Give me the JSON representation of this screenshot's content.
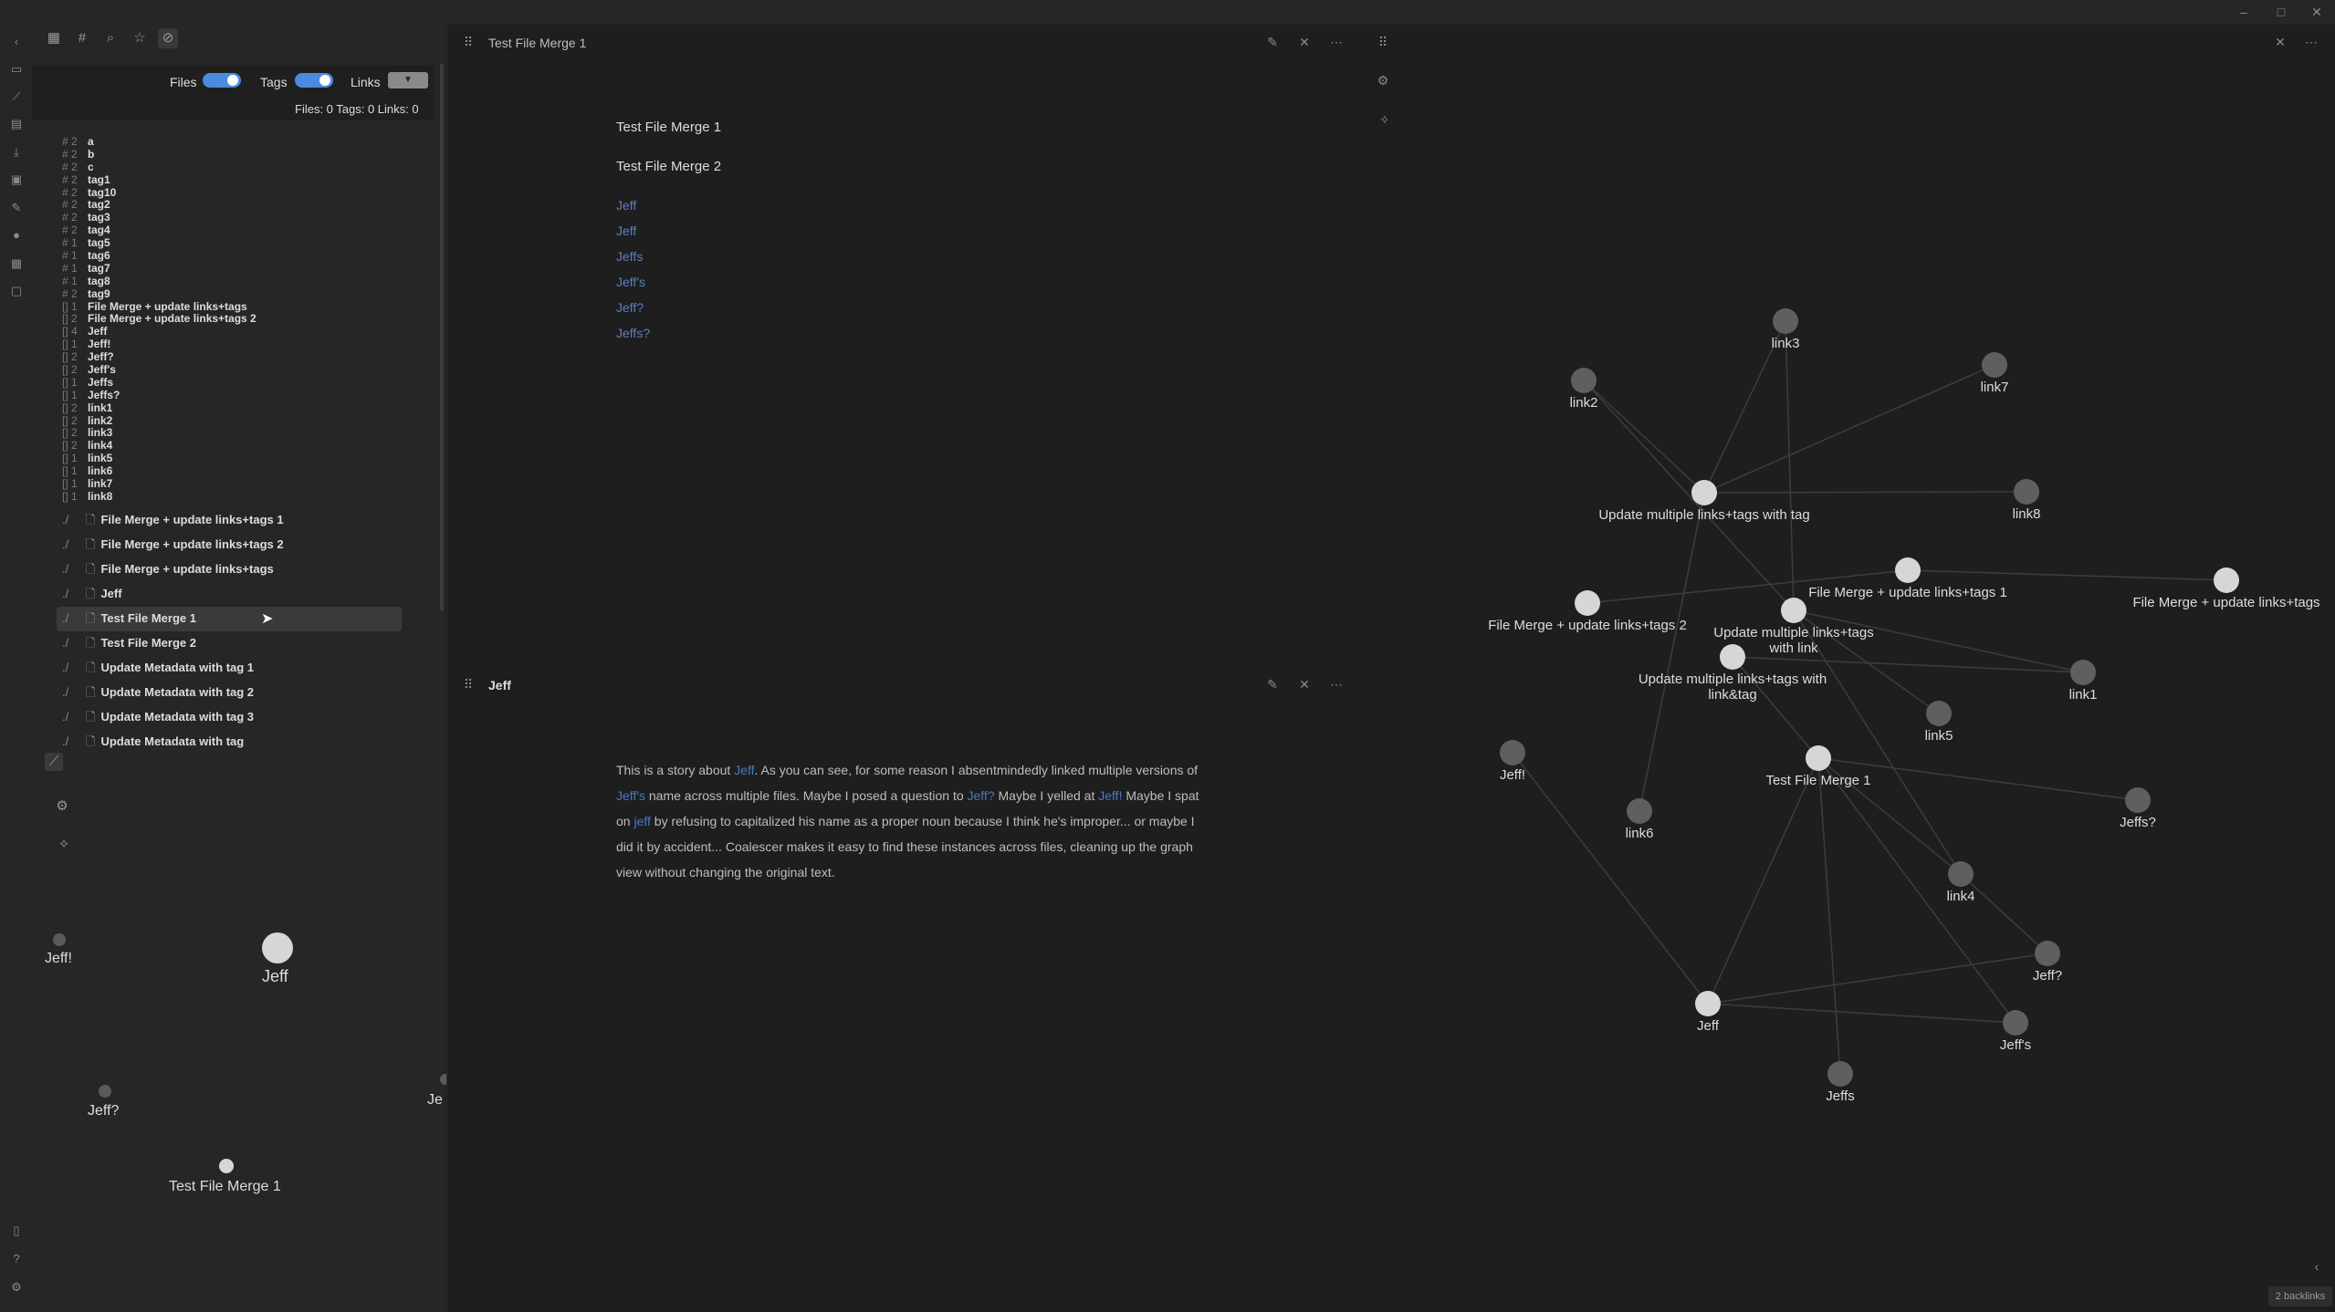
{
  "window": {
    "controls": [
      "–",
      "□",
      "✕"
    ]
  },
  "ribbon": {
    "icons": [
      "chevron-left-icon",
      "file-icon",
      "graph-icon",
      "terminal-icon",
      "download-icon",
      "inbox-icon",
      "edit-icon",
      "mic-icon",
      "table-icon",
      "calendar-icon",
      "book-icon",
      "help-icon",
      "settings-icon"
    ]
  },
  "sidebar": {
    "tab_icons": [
      "files-tab-icon",
      "tags-tab-icon",
      "search-tab-icon",
      "star-tab-icon",
      "coalescer-tab-icon"
    ],
    "filters": {
      "files_label": "Files",
      "tags_label": "Tags",
      "links_label": "Links",
      "counts": "Files: 0 Tags: 0 Links: 0",
      "files_on": true,
      "tags_on": true
    },
    "tags": [
      {
        "count": "# 2",
        "name": "a"
      },
      {
        "count": "# 2",
        "name": "b"
      },
      {
        "count": "# 2",
        "name": "c"
      },
      {
        "count": "# 2",
        "name": "tag1"
      },
      {
        "count": "# 2",
        "name": "tag10"
      },
      {
        "count": "# 2",
        "name": "tag2"
      },
      {
        "count": "# 2",
        "name": "tag3"
      },
      {
        "count": "# 2",
        "name": "tag4"
      },
      {
        "count": "# 1",
        "name": "tag5"
      },
      {
        "count": "# 1",
        "name": "tag6"
      },
      {
        "count": "# 1",
        "name": "tag7"
      },
      {
        "count": "# 1",
        "name": "tag8"
      },
      {
        "count": "# 2",
        "name": "tag9"
      },
      {
        "count": "[] 1",
        "name": "File Merge + update links+tags"
      },
      {
        "count": "[] 2",
        "name": "File Merge + update links+tags 2"
      },
      {
        "count": "[] 4",
        "name": "Jeff"
      },
      {
        "count": "[] 1",
        "name": "Jeff!"
      },
      {
        "count": "[] 2",
        "name": "Jeff?"
      },
      {
        "count": "[] 2",
        "name": "Jeff's"
      },
      {
        "count": "[] 1",
        "name": "Jeffs"
      },
      {
        "count": "[] 1",
        "name": "Jeffs?"
      },
      {
        "count": "[] 2",
        "name": "link1"
      },
      {
        "count": "[] 2",
        "name": "link2"
      },
      {
        "count": "[] 2",
        "name": "link3"
      },
      {
        "count": "[] 2",
        "name": "link4"
      },
      {
        "count": "[] 1",
        "name": "link5"
      },
      {
        "count": "[] 1",
        "name": "link6"
      },
      {
        "count": "[] 1",
        "name": "link7"
      },
      {
        "count": "[] 1",
        "name": "link8"
      }
    ],
    "files": [
      {
        "icon": "./",
        "name": "File Merge + update links+tags 1"
      },
      {
        "icon": "./",
        "name": "File Merge + update links+tags 2"
      },
      {
        "icon": "./",
        "name": "File Merge + update links+tags"
      },
      {
        "icon": "./",
        "name": "Jeff"
      },
      {
        "icon": "./",
        "name": "Test File Merge 1",
        "selected": true
      },
      {
        "icon": "./",
        "name": "Test File Merge 2"
      },
      {
        "icon": "./",
        "name": "Update Metadata with tag 1"
      },
      {
        "icon": "./",
        "name": "Update Metadata with tag 2"
      },
      {
        "icon": "./",
        "name": "Update Metadata with tag 3"
      },
      {
        "icon": "./",
        "name": "Update Metadata with tag"
      }
    ],
    "local_graph": {
      "labels": [
        "Jeff!",
        "Jeff",
        "Jeff?",
        "Je",
        "Test File Merge 1"
      ]
    }
  },
  "pane1": {
    "title": "Test File Merge 1",
    "lines": [
      "Test File Merge 1",
      "Test File Merge 2"
    ],
    "links": [
      "Jeff",
      "Jeff",
      "Jeffs",
      "Jeff's",
      "Jeff?",
      "Jeffs?"
    ]
  },
  "pane2": {
    "title": "Jeff",
    "paragraph": [
      {
        "t": "This is a story about "
      },
      {
        "t": "Jeff",
        "link": true
      },
      {
        "t": ". As you can see, for some reason I absentmindedly linked multiple versions of "
      },
      {
        "t": "Jeff's",
        "link": true
      },
      {
        "t": " name across multiple files. Maybe I posed a question to "
      },
      {
        "t": "Jeff?",
        "link": true
      },
      {
        "t": " Maybe I yelled at "
      },
      {
        "t": "Jeff!",
        "link": true
      },
      {
        "t": " Maybe I spat on "
      },
      {
        "t": "jeff",
        "link": true
      },
      {
        "t": " by refusing to capitalized his name as a proper noun because I think he's improper... or maybe I did it by accident... Coalescer makes it easy to find these instances across files, cleaning up the graph view without changing the original text."
      }
    ]
  },
  "graph": {
    "nodes": [
      {
        "id": "link3",
        "label": "link3"
      },
      {
        "id": "link2",
        "label": "link2"
      },
      {
        "id": "link7",
        "label": "link7"
      },
      {
        "id": "umlt",
        "label": "Update multiple links+tags with tag"
      },
      {
        "id": "link8",
        "label": "link8"
      },
      {
        "id": "fm1",
        "label": "File Merge + update links+tags 1"
      },
      {
        "id": "fm",
        "label": "File Merge + update links+tags"
      },
      {
        "id": "fm2",
        "label": "File Merge + update links+tags 2"
      },
      {
        "id": "umll",
        "label": "Update multiple links+tags with link"
      },
      {
        "id": "umllt",
        "label": "Update multiple links+tags with link&tag"
      },
      {
        "id": "link1",
        "label": "link1"
      },
      {
        "id": "link5",
        "label": "link5"
      },
      {
        "id": "jeffbang",
        "label": "Jeff!"
      },
      {
        "id": "tfm1",
        "label": "Test File Merge 1"
      },
      {
        "id": "link6",
        "label": "link6"
      },
      {
        "id": "jeffsq",
        "label": "Jeffs?"
      },
      {
        "id": "link4",
        "label": "link4"
      },
      {
        "id": "jeffq",
        "label": "Jeff?"
      },
      {
        "id": "jeff",
        "label": "Jeff"
      },
      {
        "id": "jeffapos",
        "label": "Jeff's"
      },
      {
        "id": "jeffs",
        "label": "Jeffs"
      }
    ],
    "edges": [
      [
        "umlt",
        "link3"
      ],
      [
        "umlt",
        "link7"
      ],
      [
        "umlt",
        "link8"
      ],
      [
        "umlt",
        "link2"
      ],
      [
        "link2",
        "umll"
      ],
      [
        "link3",
        "umll"
      ],
      [
        "fm1",
        "fm"
      ],
      [
        "fm2",
        "fm1"
      ],
      [
        "umll",
        "link1"
      ],
      [
        "umllt",
        "link1"
      ],
      [
        "umll",
        "link5"
      ],
      [
        "umll",
        "link4"
      ],
      [
        "umlt",
        "link6"
      ],
      [
        "tfm1",
        "jeffsq"
      ],
      [
        "tfm1",
        "link4"
      ],
      [
        "tfm1",
        "jeffapos"
      ],
      [
        "tfm1",
        "jeffs"
      ],
      [
        "tfm1",
        "jeff"
      ],
      [
        "jeff",
        "jeffq"
      ],
      [
        "jeff",
        "jeffapos"
      ],
      [
        "jeffbang",
        "jeff"
      ],
      [
        "link4",
        "jeffq"
      ],
      [
        "umllt",
        "tfm1"
      ]
    ],
    "backlinks": "2 backlinks"
  }
}
